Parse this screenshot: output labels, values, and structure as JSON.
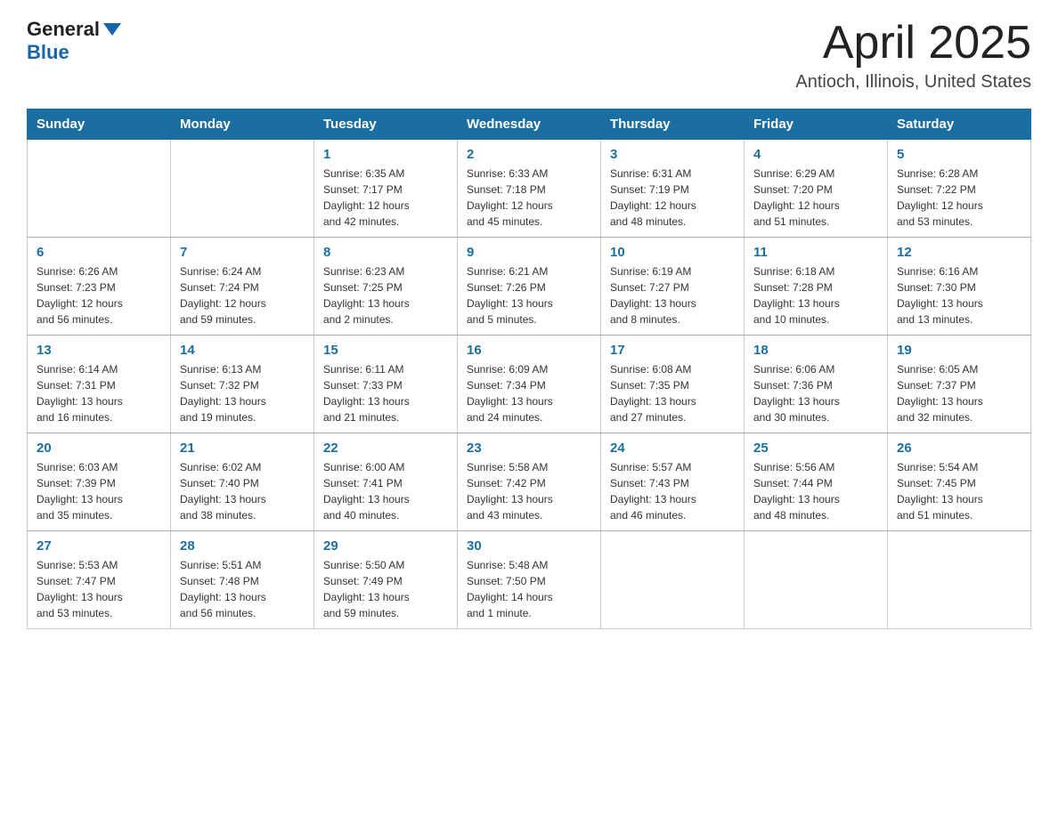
{
  "header": {
    "logo_general": "General",
    "logo_blue": "Blue",
    "month": "April 2025",
    "location": "Antioch, Illinois, United States"
  },
  "weekdays": [
    "Sunday",
    "Monday",
    "Tuesday",
    "Wednesday",
    "Thursday",
    "Friday",
    "Saturday"
  ],
  "weeks": [
    [
      {
        "day": "",
        "info": ""
      },
      {
        "day": "",
        "info": ""
      },
      {
        "day": "1",
        "info": "Sunrise: 6:35 AM\nSunset: 7:17 PM\nDaylight: 12 hours\nand 42 minutes."
      },
      {
        "day": "2",
        "info": "Sunrise: 6:33 AM\nSunset: 7:18 PM\nDaylight: 12 hours\nand 45 minutes."
      },
      {
        "day": "3",
        "info": "Sunrise: 6:31 AM\nSunset: 7:19 PM\nDaylight: 12 hours\nand 48 minutes."
      },
      {
        "day": "4",
        "info": "Sunrise: 6:29 AM\nSunset: 7:20 PM\nDaylight: 12 hours\nand 51 minutes."
      },
      {
        "day": "5",
        "info": "Sunrise: 6:28 AM\nSunset: 7:22 PM\nDaylight: 12 hours\nand 53 minutes."
      }
    ],
    [
      {
        "day": "6",
        "info": "Sunrise: 6:26 AM\nSunset: 7:23 PM\nDaylight: 12 hours\nand 56 minutes."
      },
      {
        "day": "7",
        "info": "Sunrise: 6:24 AM\nSunset: 7:24 PM\nDaylight: 12 hours\nand 59 minutes."
      },
      {
        "day": "8",
        "info": "Sunrise: 6:23 AM\nSunset: 7:25 PM\nDaylight: 13 hours\nand 2 minutes."
      },
      {
        "day": "9",
        "info": "Sunrise: 6:21 AM\nSunset: 7:26 PM\nDaylight: 13 hours\nand 5 minutes."
      },
      {
        "day": "10",
        "info": "Sunrise: 6:19 AM\nSunset: 7:27 PM\nDaylight: 13 hours\nand 8 minutes."
      },
      {
        "day": "11",
        "info": "Sunrise: 6:18 AM\nSunset: 7:28 PM\nDaylight: 13 hours\nand 10 minutes."
      },
      {
        "day": "12",
        "info": "Sunrise: 6:16 AM\nSunset: 7:30 PM\nDaylight: 13 hours\nand 13 minutes."
      }
    ],
    [
      {
        "day": "13",
        "info": "Sunrise: 6:14 AM\nSunset: 7:31 PM\nDaylight: 13 hours\nand 16 minutes."
      },
      {
        "day": "14",
        "info": "Sunrise: 6:13 AM\nSunset: 7:32 PM\nDaylight: 13 hours\nand 19 minutes."
      },
      {
        "day": "15",
        "info": "Sunrise: 6:11 AM\nSunset: 7:33 PM\nDaylight: 13 hours\nand 21 minutes."
      },
      {
        "day": "16",
        "info": "Sunrise: 6:09 AM\nSunset: 7:34 PM\nDaylight: 13 hours\nand 24 minutes."
      },
      {
        "day": "17",
        "info": "Sunrise: 6:08 AM\nSunset: 7:35 PM\nDaylight: 13 hours\nand 27 minutes."
      },
      {
        "day": "18",
        "info": "Sunrise: 6:06 AM\nSunset: 7:36 PM\nDaylight: 13 hours\nand 30 minutes."
      },
      {
        "day": "19",
        "info": "Sunrise: 6:05 AM\nSunset: 7:37 PM\nDaylight: 13 hours\nand 32 minutes."
      }
    ],
    [
      {
        "day": "20",
        "info": "Sunrise: 6:03 AM\nSunset: 7:39 PM\nDaylight: 13 hours\nand 35 minutes."
      },
      {
        "day": "21",
        "info": "Sunrise: 6:02 AM\nSunset: 7:40 PM\nDaylight: 13 hours\nand 38 minutes."
      },
      {
        "day": "22",
        "info": "Sunrise: 6:00 AM\nSunset: 7:41 PM\nDaylight: 13 hours\nand 40 minutes."
      },
      {
        "day": "23",
        "info": "Sunrise: 5:58 AM\nSunset: 7:42 PM\nDaylight: 13 hours\nand 43 minutes."
      },
      {
        "day": "24",
        "info": "Sunrise: 5:57 AM\nSunset: 7:43 PM\nDaylight: 13 hours\nand 46 minutes."
      },
      {
        "day": "25",
        "info": "Sunrise: 5:56 AM\nSunset: 7:44 PM\nDaylight: 13 hours\nand 48 minutes."
      },
      {
        "day": "26",
        "info": "Sunrise: 5:54 AM\nSunset: 7:45 PM\nDaylight: 13 hours\nand 51 minutes."
      }
    ],
    [
      {
        "day": "27",
        "info": "Sunrise: 5:53 AM\nSunset: 7:47 PM\nDaylight: 13 hours\nand 53 minutes."
      },
      {
        "day": "28",
        "info": "Sunrise: 5:51 AM\nSunset: 7:48 PM\nDaylight: 13 hours\nand 56 minutes."
      },
      {
        "day": "29",
        "info": "Sunrise: 5:50 AM\nSunset: 7:49 PM\nDaylight: 13 hours\nand 59 minutes."
      },
      {
        "day": "30",
        "info": "Sunrise: 5:48 AM\nSunset: 7:50 PM\nDaylight: 14 hours\nand 1 minute."
      },
      {
        "day": "",
        "info": ""
      },
      {
        "day": "",
        "info": ""
      },
      {
        "day": "",
        "info": ""
      }
    ]
  ]
}
